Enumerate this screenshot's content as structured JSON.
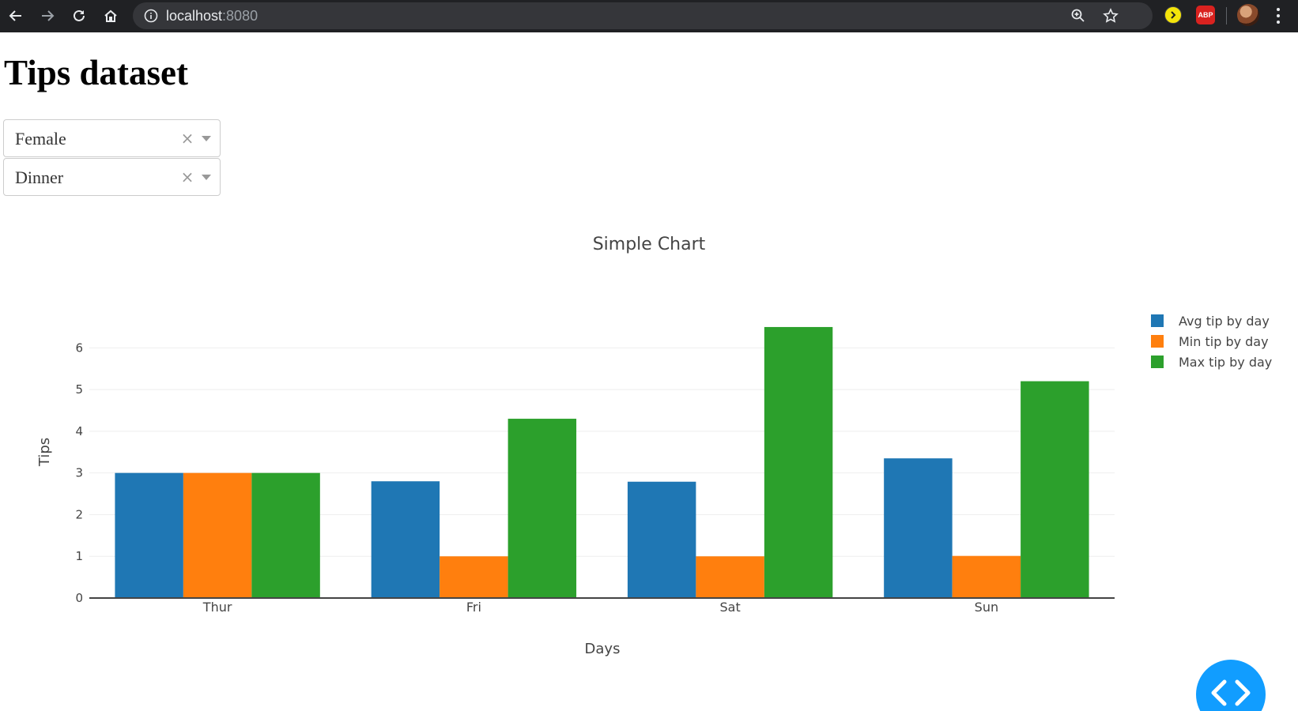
{
  "browser": {
    "url_host": "localhost",
    "url_port": ":8080",
    "icons": [
      "back-icon",
      "forward-icon",
      "reload-icon",
      "home-icon",
      "info-icon",
      "zoom-icon",
      "star-icon",
      "extension-icon",
      "adblock-icon",
      "profile-avatar",
      "menu-icon"
    ],
    "abp_label": "ABP"
  },
  "page": {
    "title": "Tips dataset"
  },
  "filters": [
    {
      "value": "Female",
      "clear": "×"
    },
    {
      "value": "Dinner",
      "clear": "×"
    }
  ],
  "colors": {
    "avg": "#1f77b4",
    "min": "#ff7f0e",
    "max": "#2ca02c",
    "grid": "#eeeeee",
    "axis_text": "#444444",
    "fab": "#119dff"
  },
  "chart_data": {
    "type": "bar",
    "title": "Simple Chart",
    "xlabel": "Days",
    "ylabel": "Tips",
    "categories": [
      "Thur",
      "Fri",
      "Sat",
      "Sun"
    ],
    "series": [
      {
        "name": "Avg tip by day",
        "values": [
          3.0,
          2.8,
          2.79,
          3.35
        ],
        "color": "#1f77b4"
      },
      {
        "name": "Min tip by day",
        "values": [
          3.0,
          1.0,
          1.0,
          1.01
        ],
        "color": "#ff7f0e"
      },
      {
        "name": "Max tip by day",
        "values": [
          3.0,
          4.3,
          6.5,
          5.2
        ],
        "color": "#2ca02c"
      }
    ],
    "ylim": [
      0,
      6.84
    ],
    "yticks": [
      0,
      1,
      2,
      3,
      4,
      5,
      6
    ],
    "grid": true,
    "legend": "top-right"
  }
}
